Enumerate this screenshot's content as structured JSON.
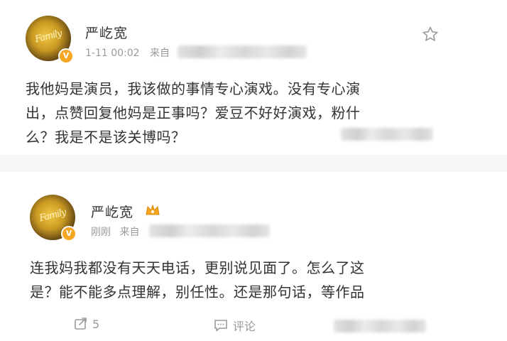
{
  "posts": [
    {
      "username": "严屹宽",
      "avatar_text": "Family",
      "timestamp": "1-11 00:02",
      "source_prefix": "来自",
      "text": "我他妈是演员，我该做的事情专心演戏。没有专心演\n出，点赞回复他妈是正事吗？爱豆不好好演戏，粉什\n么？我是不是该关博吗？"
    },
    {
      "username": "严屹宽",
      "avatar_text": "Family",
      "timestamp": "刚刚",
      "source_prefix": "来自",
      "text": "连我妈我都没有天天电话，更别说见面了。怎么了这\n是？能不能多点理解，别任性。还是那句话，等作品"
    }
  ],
  "actions": {
    "repost_count": "5",
    "comment_label": "评论"
  },
  "icons": {
    "favorite": "star-outline-icon",
    "member_badge": "crown-badge-icon",
    "verified": "verified-v-icon",
    "repost": "repost-icon",
    "comment": "comment-icon"
  },
  "colors": {
    "username": "#333333",
    "meta": "#999999",
    "badge": "#f5a623",
    "background": "#f6f6f6"
  }
}
